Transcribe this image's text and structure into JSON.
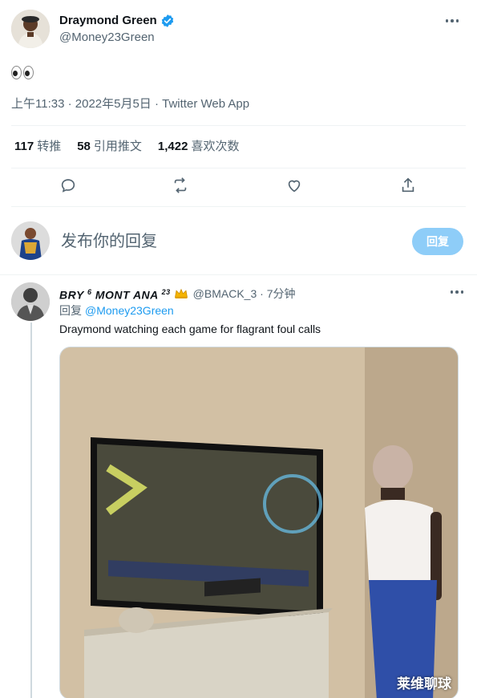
{
  "tweet": {
    "author": {
      "name": "Draymond Green",
      "handle": "@Money23Green",
      "verified": true,
      "verified_color": "#1d9bf0"
    },
    "emoji_text": "👀",
    "meta": "上午11:33 · 2022年5月5日 · Twitter Web App",
    "stats": {
      "retweets": {
        "count": "117",
        "label": "转推"
      },
      "quotes": {
        "count": "58",
        "label": "引用推文"
      },
      "likes": {
        "count": "1,422",
        "label": "喜欢次数"
      }
    },
    "actions": [
      "reply-icon",
      "retweet-icon",
      "like-icon",
      "share-icon"
    ]
  },
  "composer": {
    "placeholder": "发布你的回复",
    "button_label": "回复",
    "button_color": "#8ecdf8"
  },
  "reply": {
    "name_parts": {
      "a": "BRY ",
      "sup1": "6",
      "b": " MONT ANA ",
      "sup2": "23"
    },
    "handle": "@BMACK_3",
    "time": "7分钟",
    "replying_prefix": "回复",
    "replying_to": "@Money23Green",
    "text": "Draymond watching each game for flagrant foul calls",
    "watermark": "莱维聊球"
  },
  "colors": {
    "link": "#1d9bf0",
    "secondary_text": "#536471",
    "divider": "#eff3f4"
  }
}
